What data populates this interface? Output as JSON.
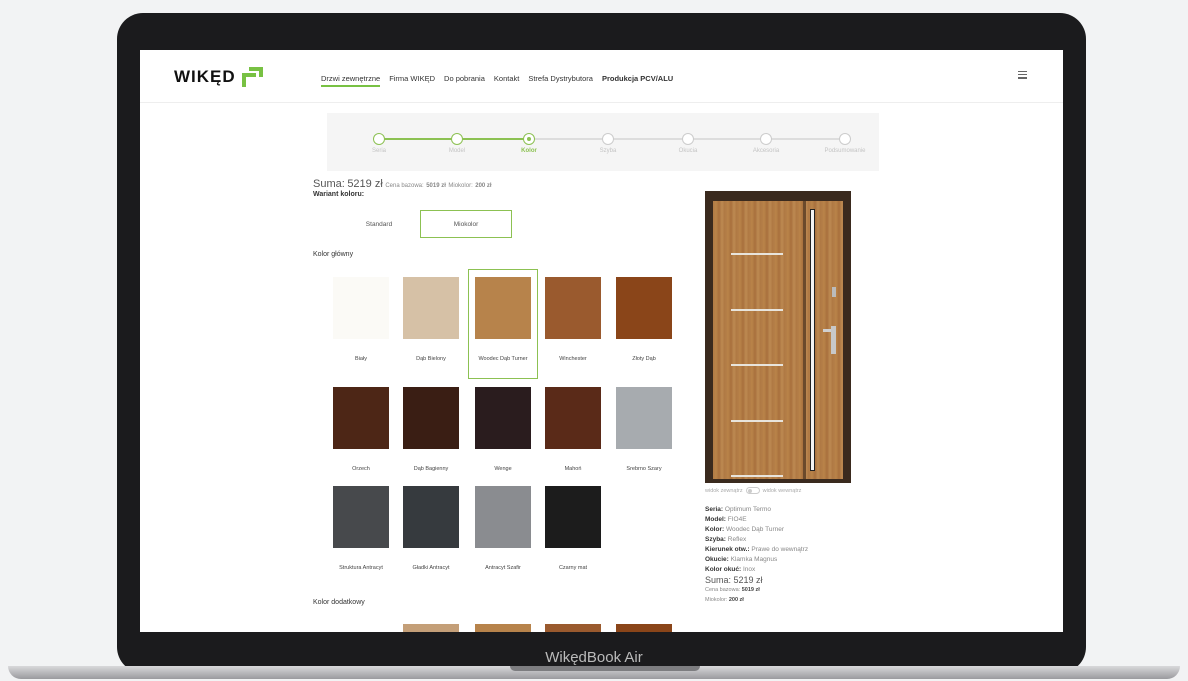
{
  "device": {
    "label": "WikędBook Air"
  },
  "header": {
    "logo_text": "WIKĘD",
    "nav": [
      "Drzwi zewnętrzne",
      "Firma WIKĘD",
      "Do pobrania",
      "Kontakt",
      "Strefa Dystrybutora",
      "Produkcja PCV/ALU"
    ],
    "menu_icon": "hamburger-icon"
  },
  "stepper": {
    "steps": [
      "Seria",
      "Model",
      "Kolor",
      "Szyba",
      "Okucia",
      "Akcesoria",
      "Podsumowanie"
    ],
    "current_index": 2
  },
  "summary": {
    "label": "Suma:",
    "total": "5219 zł",
    "breakdown_label": "Cena bazowa:",
    "base": "5019 zł",
    "extra_label": "Miokolor:",
    "extra": "200 zł"
  },
  "variant": {
    "label": "Wariant koloru:",
    "options": [
      "Standard",
      "Miokolor"
    ],
    "selected": "Miokolor"
  },
  "main_color": {
    "label": "Kolor główny",
    "selected": "Woodec Dąb Turner",
    "swatches": [
      {
        "name": "Biały",
        "color": "#fbfaf6"
      },
      {
        "name": "Dąb Bielony",
        "color": "#d6c1a6"
      },
      {
        "name": "Woodec Dąb Turner",
        "color": "#b7834b"
      },
      {
        "name": "Winchester",
        "color": "#9a5a2e"
      },
      {
        "name": "Złoty Dąb",
        "color": "#8a4519"
      },
      {
        "name": "Orzech",
        "color": "#4d2616"
      },
      {
        "name": "Dąb Bagienny",
        "color": "#3a1e14"
      },
      {
        "name": "Wenge",
        "color": "#2a1c1e"
      },
      {
        "name": "Mahoń",
        "color": "#5a2a18"
      },
      {
        "name": "Srebrno Szary",
        "color": "#a7abaf"
      },
      {
        "name": "Struktura Antracyt",
        "color": "#47494c"
      },
      {
        "name": "Gładki Antracyt",
        "color": "#363a3e"
      },
      {
        "name": "Antracyt Szafir",
        "color": "#8a8c90"
      },
      {
        "name": "Czarny mat",
        "color": "#1c1c1c"
      }
    ]
  },
  "extra_color": {
    "label": "Kolor dodatkowy",
    "peek_colors": [
      "#c49f78",
      "#b7834b",
      "#9a5a2e",
      "#8a4519"
    ]
  },
  "preview": {
    "toggle_left": "widok zewnątrz",
    "toggle_right": "widok wewnątrz",
    "specs": [
      {
        "label": "Seria:",
        "value": "Optimum Termo"
      },
      {
        "label": "Model:",
        "value": "FIO4E"
      },
      {
        "label": "Kolor:",
        "value": "Woodec Dąb Turner"
      },
      {
        "label": "Szyba:",
        "value": "Reflex"
      },
      {
        "label": "Kierunek otw.:",
        "value": "Prawe do wewnątrz"
      },
      {
        "label": "Okucie:",
        "value": "Klamka Magnus"
      },
      {
        "label": "Kolor okuć:",
        "value": "Inox"
      }
    ],
    "sum_label": "Suma:",
    "sum_value": "5219 zł",
    "base_label": "Cena bazowa:",
    "base_value": "5019 zł",
    "extra_label": "Miokolor:",
    "extra_value": "200 zł"
  }
}
